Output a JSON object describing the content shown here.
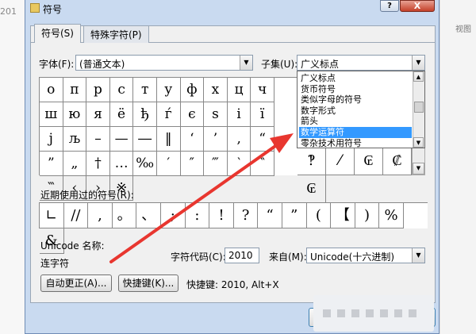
{
  "background": {
    "left_text": "201",
    "right_text": "视图"
  },
  "dialog": {
    "title": "符号",
    "help_label": "?",
    "close_label": "X"
  },
  "tabs": [
    {
      "label": "符号(S)",
      "active": true
    },
    {
      "label": "特殊字符(P)",
      "active": false
    }
  ],
  "font": {
    "label": "字体(F):",
    "value": "(普通文本)"
  },
  "subset": {
    "label": "子集(U):",
    "value": "广义标点",
    "options": [
      "广义标点",
      "货币符号",
      "类似字母的符号",
      "数字形式",
      "箭头",
      "数学运算符",
      "零杂技术用符号"
    ],
    "selected_index": 5
  },
  "symbol_grid": {
    "rows": [
      [
        "о",
        "п",
        "р",
        "с",
        "т",
        "у",
        "ф",
        "х",
        "ц",
        "ч",
        "ш"
      ],
      [
        "ю",
        "я",
        "ё",
        "ђ",
        "ѓ",
        "є",
        "ѕ",
        "і",
        "ї",
        "ј",
        "љ"
      ],
      [
        "–",
        "—",
        "―",
        "‖",
        "‘",
        "’",
        "‚",
        "“",
        "”",
        "„",
        "†"
      ],
      [
        "…",
        "‰",
        "′",
        "″",
        "‴",
        "‵",
        "‶",
        "‷",
        "‹",
        "›",
        "※"
      ]
    ],
    "extra_cells": [
      "‽",
      "⁄",
      "₢",
      "₡",
      "₢"
    ]
  },
  "recent": {
    "label": "近期使用过的符号(R):",
    "symbols": [
      "∟",
      "//",
      ",",
      "。",
      "、",
      ";",
      ":",
      "!",
      "?",
      "“",
      "”",
      "(",
      "【",
      ")",
      "%",
      "&"
    ]
  },
  "unicode_name": {
    "label": "Unicode 名称:",
    "value": "连字符"
  },
  "char_code": {
    "label": "字符代码(C):",
    "value": "2010"
  },
  "from": {
    "label": "来自(M):",
    "value": "Unicode(十六进制)"
  },
  "buttons": {
    "autocorrect": "自动更正(A)...",
    "shortcut": "快捷键(K)...",
    "shortcut_info": "快捷键: 2010, Alt+X"
  },
  "colors": {
    "selection": "#3399ff",
    "annotation_arrow": "#e8362f",
    "dialog_frame": "#c9daf0"
  }
}
